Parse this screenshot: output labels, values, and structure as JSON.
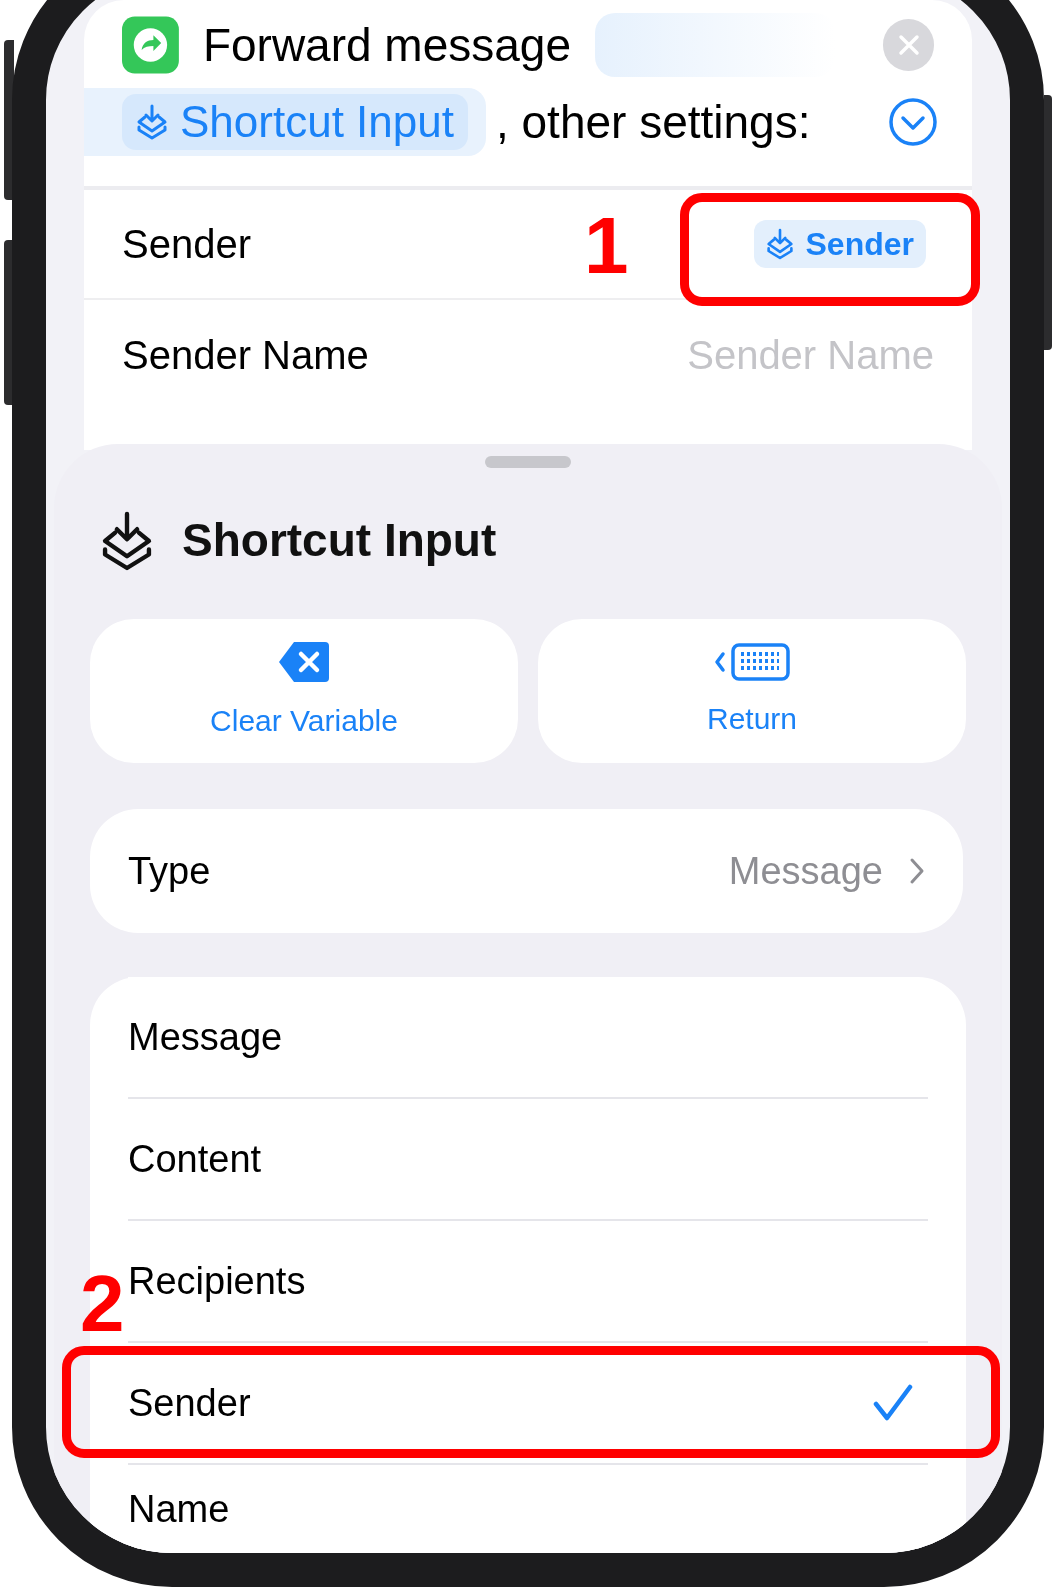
{
  "action": {
    "title": "Forward message",
    "input_token": "Shortcut Input",
    "suffix": ", other settings:"
  },
  "fields": [
    {
      "label": "Sender",
      "kind": "token",
      "value": "Sender"
    },
    {
      "label": "Sender Name",
      "kind": "text",
      "placeholder": "Sender Name"
    }
  ],
  "sheet": {
    "title": "Shortcut Input",
    "buttons": [
      {
        "label": "Clear Variable",
        "kind": "clear"
      },
      {
        "label": "Return",
        "kind": "return"
      }
    ],
    "type_row": {
      "label": "Type",
      "value": "Message"
    },
    "properties": [
      {
        "label": "Message",
        "selected": false
      },
      {
        "label": "Content",
        "selected": false
      },
      {
        "label": "Recipients",
        "selected": false
      },
      {
        "label": "Sender",
        "selected": true
      },
      {
        "label": "Name",
        "selected": false
      }
    ]
  },
  "annotations": [
    {
      "label": "1"
    },
    {
      "label": "2"
    }
  ]
}
